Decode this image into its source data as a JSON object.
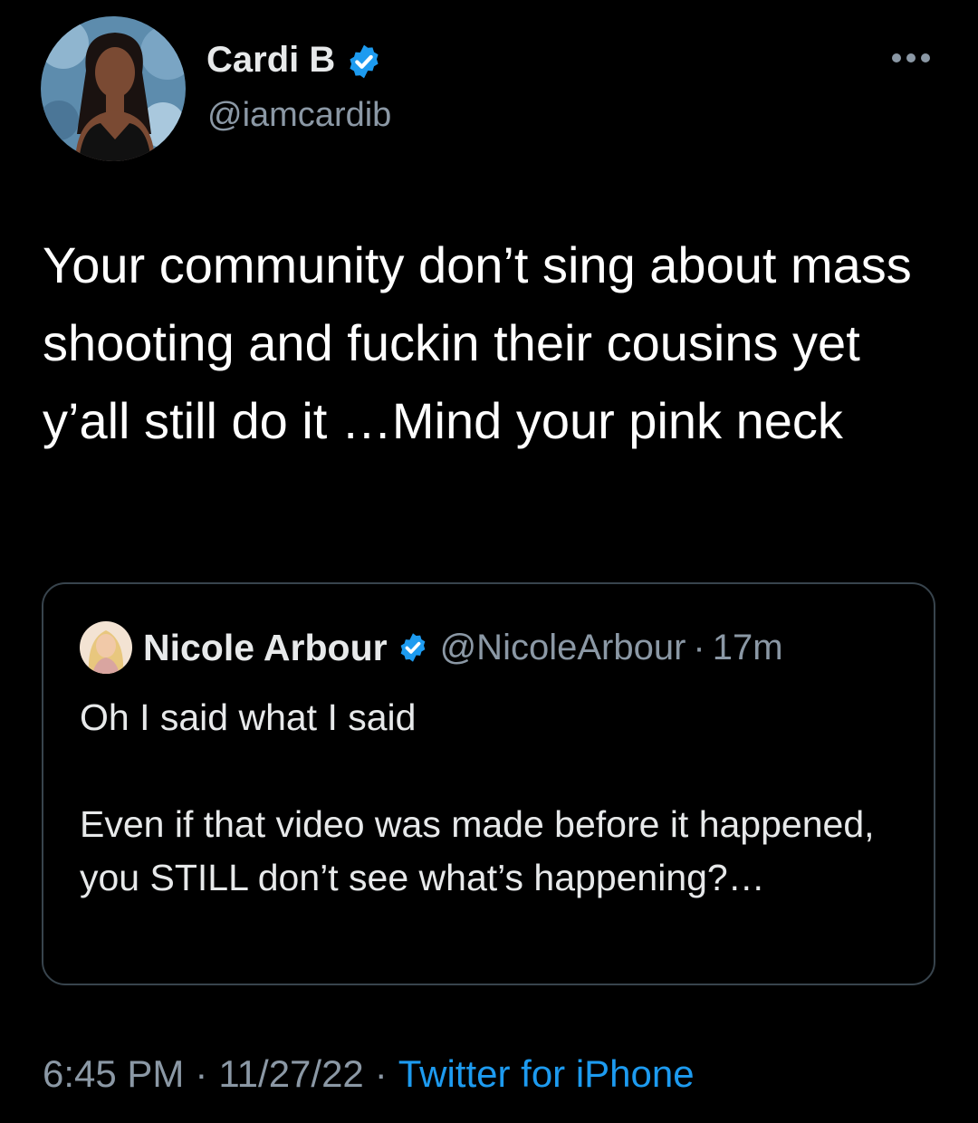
{
  "author": {
    "name": "Cardi B",
    "handle": "@iamcardib",
    "verified": true,
    "avatar_icon": "profile-photo"
  },
  "more_icon": "ellipsis-icon",
  "tweet": {
    "text": "Your community don’t sing about mass shooting and fuckin their cousins yet y’all still do it …Mind your pink neck"
  },
  "quoted_tweet": {
    "name": "Nicole Arbour",
    "handle": "@NicoleArbour",
    "separator": "·",
    "time": "17m",
    "verified": true,
    "paragraph_1": "Oh I said what I said",
    "paragraph_2": "Even if that video was made before it happened, you STILL don’t see what’s happening?…"
  },
  "meta": {
    "time": "6:45 PM",
    "separator": "·",
    "date": "11/27/22",
    "source": "Twitter for iPhone"
  },
  "colors": {
    "background": "#000000",
    "text": "#e7e9ea",
    "muted": "#8b98a5",
    "accent": "#1d9bf0",
    "border": "#38444d"
  }
}
